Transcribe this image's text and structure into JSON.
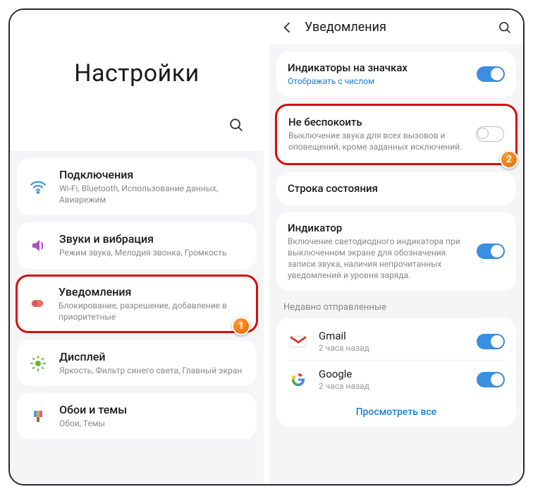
{
  "left": {
    "title": "Настройки",
    "items": [
      {
        "title": "Подключения",
        "sub": "Wi-Fi, Bluetooth, Использование данных, Авиарежим"
      },
      {
        "title": "Звуки и вибрация",
        "sub": "Режим звука, Мелодия звонка, Громкость"
      },
      {
        "title": "Уведомления",
        "sub": "Блокирование, разрешение, добавление в приоритетные"
      },
      {
        "title": "Дисплей",
        "sub": "Яркость, Фильтр синего света, Главный экран"
      },
      {
        "title": "Обои и темы",
        "sub": "Обои, Темы"
      }
    ],
    "badge1": "1"
  },
  "right": {
    "header": "Уведомления",
    "badge_indicators": {
      "title": "Индикаторы на значках",
      "sub": "Отображать с числом"
    },
    "dnd": {
      "title": "Не беспокоить",
      "sub": "Выключение звука для всех вызовов и оповещений, кроме заданных исключений."
    },
    "status_bar": {
      "title": "Строка состояния"
    },
    "indicator": {
      "title": "Индикатор",
      "sub": "Включение светодиодного индикатора при выключенном экране для обозначения записи звука, наличия непрочитанных уведомлений и уровня заряда."
    },
    "recent_label": "Недавно отправленные",
    "apps": [
      {
        "title": "Gmail",
        "sub": "2 часа назад"
      },
      {
        "title": "Google",
        "sub": "2 часа назад"
      }
    ],
    "view_all": "Просмотреть все",
    "badge2": "2"
  }
}
